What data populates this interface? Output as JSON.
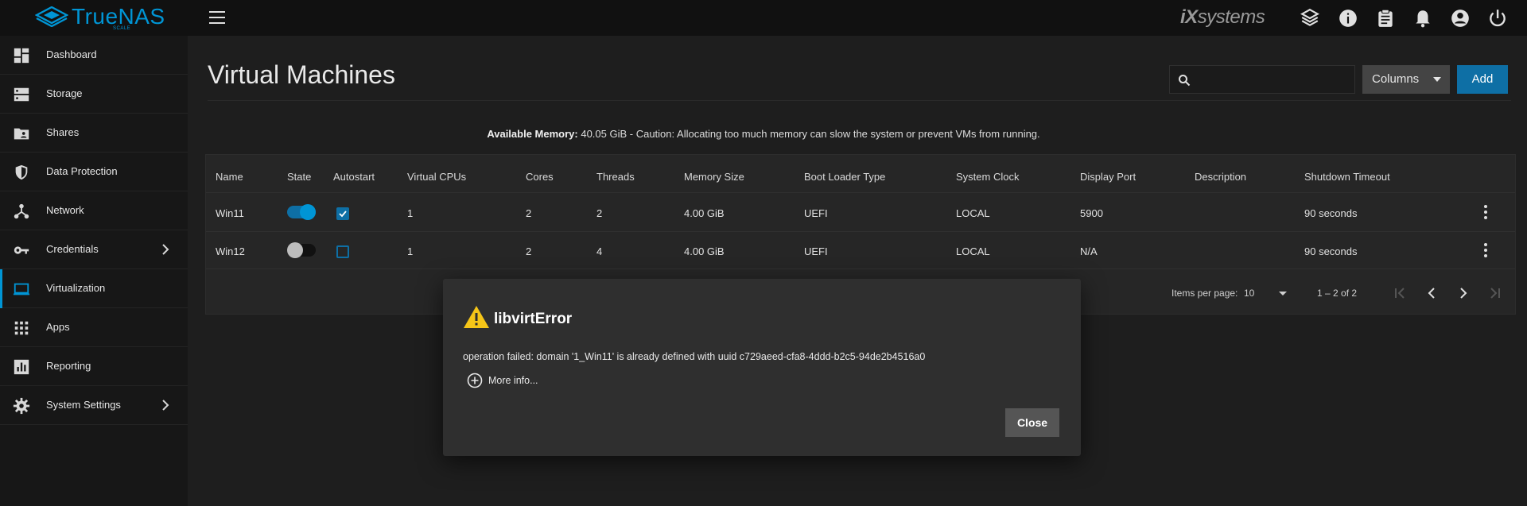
{
  "app": {
    "logo_text": "TrueNAS",
    "logo_sub": "SCALE",
    "vendor_logo": {
      "prefix": "iX",
      "suffix": "systems"
    }
  },
  "sidebar": {
    "items": [
      {
        "label": "Dashboard",
        "icon": "dashboard-icon"
      },
      {
        "label": "Storage",
        "icon": "storage-icon"
      },
      {
        "label": "Shares",
        "icon": "shares-icon"
      },
      {
        "label": "Data Protection",
        "icon": "shield-icon"
      },
      {
        "label": "Network",
        "icon": "network-icon"
      },
      {
        "label": "Credentials",
        "icon": "key-icon"
      },
      {
        "label": "Virtualization",
        "icon": "laptop-icon"
      },
      {
        "label": "Apps",
        "icon": "apps-grid-icon"
      },
      {
        "label": "Reporting",
        "icon": "bar-chart-icon"
      },
      {
        "label": "System Settings",
        "icon": "gear-icon"
      }
    ],
    "active": "Virtualization"
  },
  "page": {
    "title": "Virtual Machines",
    "search_placeholder": "",
    "columns_label": "Columns",
    "add_label": "Add",
    "memory_label": "Available Memory:",
    "memory_text": " 40.05 GiB - Caution: Allocating too much memory can slow the system or prevent VMs from running."
  },
  "table": {
    "headers": [
      "Name",
      "State",
      "Autostart",
      "Virtual CPUs",
      "Cores",
      "Threads",
      "Memory Size",
      "Boot Loader Type",
      "System Clock",
      "Display Port",
      "Description",
      "Shutdown Timeout"
    ],
    "rows": [
      {
        "name": "Win11",
        "state_on": true,
        "autostart": true,
        "vcpus": "1",
        "cores": "2",
        "threads": "2",
        "memory": "4.00 GiB",
        "bootloader": "UEFI",
        "clock": "LOCAL",
        "display_port": "5900",
        "description": "",
        "shutdown": "90 seconds"
      },
      {
        "name": "Win12",
        "state_on": false,
        "autostart": false,
        "vcpus": "1",
        "cores": "2",
        "threads": "4",
        "memory": "4.00 GiB",
        "bootloader": "UEFI",
        "clock": "LOCAL",
        "display_port": "N/A",
        "description": "",
        "shutdown": "90 seconds"
      }
    ],
    "pager": {
      "items_per_page_label": "Items per page:",
      "items_per_page": "10",
      "range": "1 – 2 of 2"
    }
  },
  "dialog": {
    "title": "libvirtError",
    "message": "operation failed: domain '1_Win11' is already defined with uuid c729aeed-cfa8-4ddd-b2c5-94de2b4516a0",
    "more_info": "More info...",
    "close_label": "Close"
  },
  "colors": {
    "accent": "#0095d5",
    "button_primary": "#0e6fa5",
    "warning": "#f5c518"
  }
}
